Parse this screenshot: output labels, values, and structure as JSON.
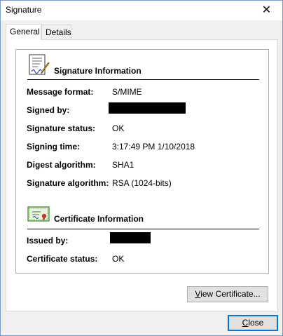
{
  "window": {
    "title": "Signature",
    "close_glyph": "✕"
  },
  "tabs": [
    {
      "label": "General",
      "active": true
    },
    {
      "label": "Details",
      "active": false
    }
  ],
  "signature_section": {
    "title": "Signature Information",
    "icon": "signed-document-icon",
    "rows": [
      {
        "label": "Message format:",
        "value": "S/MIME"
      },
      {
        "label": "Signed by:",
        "value": ""
      },
      {
        "label": "Signature status:",
        "value": "OK"
      },
      {
        "label": "Signing time:",
        "value": "3:17:49 PM 1/10/2018"
      },
      {
        "label": "Digest algorithm:",
        "value": "SHA1"
      },
      {
        "label": "Signature algorithm:",
        "value": "RSA (1024-bits)"
      }
    ]
  },
  "certificate_section": {
    "title": "Certificate Information",
    "icon": "certificate-icon",
    "rows": [
      {
        "label": "Issued by:",
        "value": ""
      },
      {
        "label": "Certificate status:",
        "value": "OK"
      }
    ]
  },
  "buttons": {
    "view_certificate": {
      "accel": "V",
      "rest": "iew Certificate..."
    },
    "close": {
      "accel": "C",
      "rest": "lose"
    }
  },
  "colors": {
    "accent": "#0078d7",
    "rule": "#000000",
    "redaction": "#000000"
  }
}
